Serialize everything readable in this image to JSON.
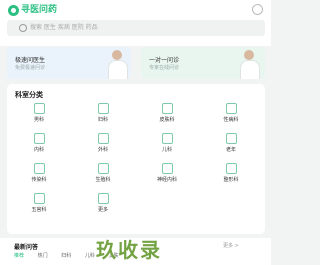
{
  "header": {
    "logo_text": "寻医问药",
    "search_placeholder": "搜索 医生  疾病  医院  药品"
  },
  "cards": [
    {
      "title": "极速问医生",
      "subtitle": "免费极速问诊"
    },
    {
      "title": "一对一问诊",
      "subtitle": "专家在线问诊"
    }
  ],
  "department": {
    "title": "科室分类",
    "items": [
      "男科",
      "妇科",
      "皮肤科",
      "性病科",
      "内科",
      "外科",
      "儿科",
      "老年",
      "传染科",
      "生殖科",
      "神经内科",
      "整形科",
      "五官科",
      "更多"
    ]
  },
  "news": {
    "title": "最新问答",
    "more": "更多 >",
    "tabs": [
      "推荐",
      "热门",
      "妇科",
      "儿科",
      "皮肤"
    ],
    "watermark": "玖收录"
  }
}
